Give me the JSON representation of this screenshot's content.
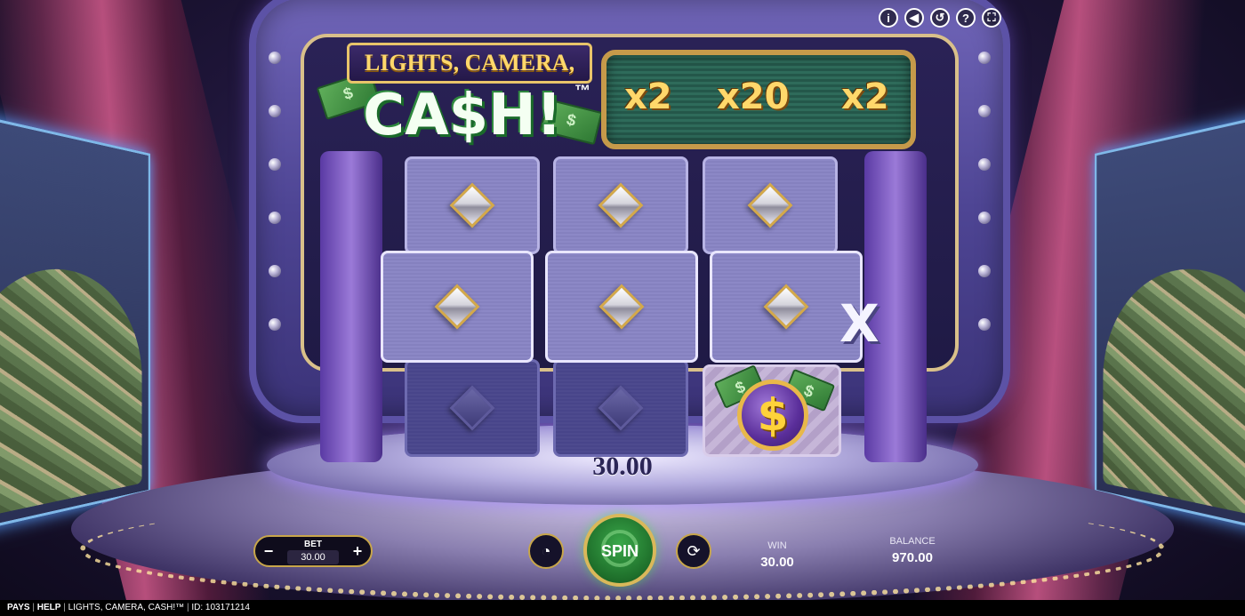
{
  "game": {
    "logo_top": "LIGHTS, CAMERA,",
    "logo_main": "CA$H!",
    "logo_tm": "™",
    "multipliers": [
      "x2",
      "x20",
      "x2"
    ],
    "x_mark": "X",
    "win_display": "30.00",
    "coin_symbol": "$"
  },
  "top_bar": {
    "icons": [
      {
        "name": "info-icon",
        "glyph": "i"
      },
      {
        "name": "sound-icon",
        "glyph": "◀"
      },
      {
        "name": "history-icon",
        "glyph": "↺"
      },
      {
        "name": "help-icon",
        "glyph": "?"
      },
      {
        "name": "fullscreen-icon",
        "glyph": "⛶"
      }
    ]
  },
  "controls": {
    "bet_label": "BET",
    "bet_value": "30.00",
    "bet_minus": "−",
    "bet_plus": "+",
    "spin_label": "SPIN",
    "turbo_glyph": "◔",
    "autoplay_glyph": "⟳"
  },
  "stats": {
    "win_label": "WIN",
    "win_value": "30.00",
    "balance_label": "BALANCE",
    "balance_value": "970.00"
  },
  "footer": {
    "pays": "PAYS",
    "help": "HELP",
    "title": "LIGHTS, CAMERA, CASH!™",
    "id": "ID: 103171214",
    "sep": "|"
  },
  "colors": {
    "accent_gold": "#c8a64a",
    "spin_green": "#1e6e2a",
    "multiplier_gold": "#ffd86b"
  }
}
